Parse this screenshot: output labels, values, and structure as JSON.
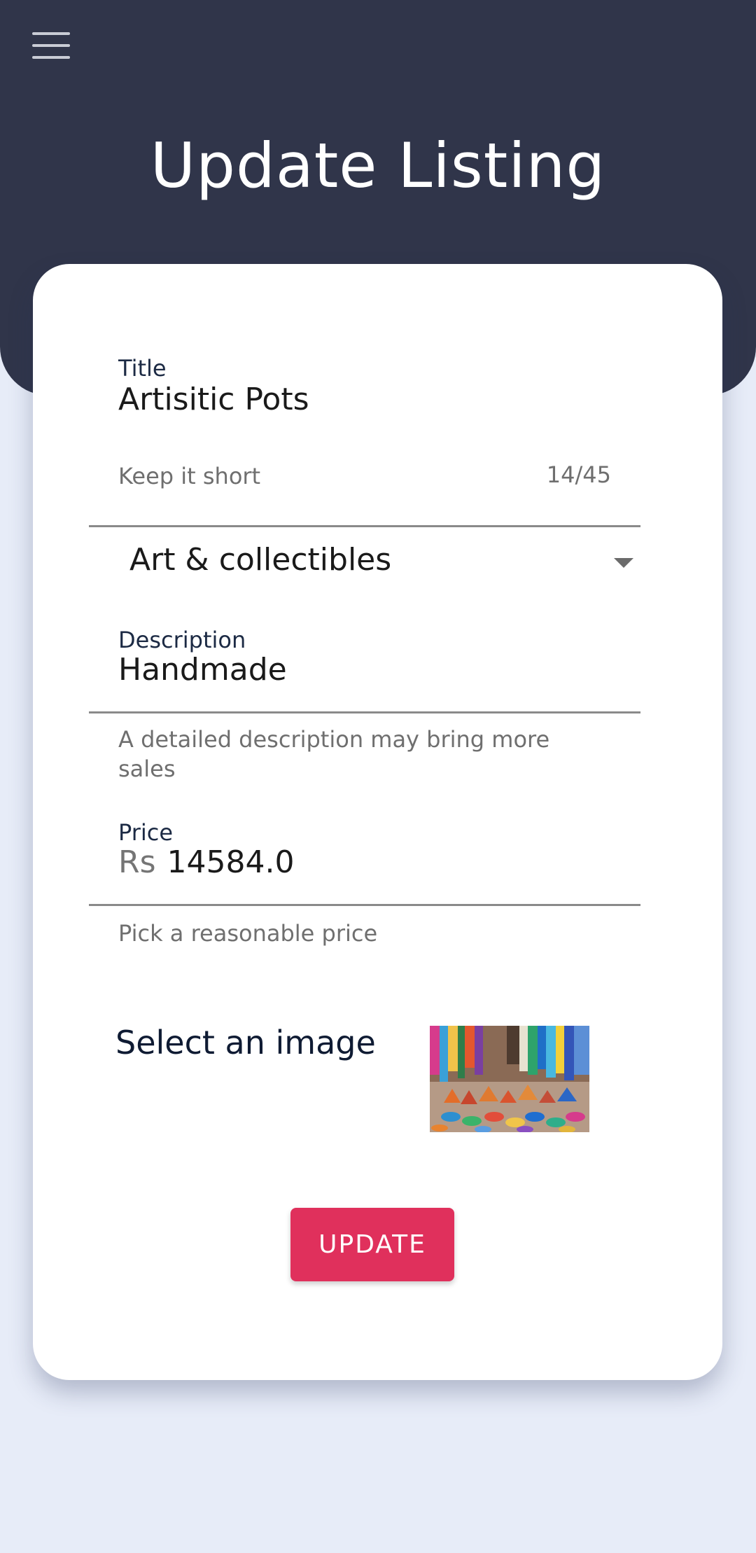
{
  "header": {
    "title": "Update Listing",
    "menu_icon": "hamburger-menu-icon",
    "background_color": "#30354a"
  },
  "form": {
    "title_field": {
      "label": "Title",
      "value": "Artisitic Pots",
      "helper": "Keep it short",
      "counter": "14/45"
    },
    "category": {
      "selected": "Art & collectibles",
      "dropdown_icon": "dropdown-arrow-icon"
    },
    "description_field": {
      "label": "Description",
      "value": "Handmade",
      "helper": "A detailed description may bring more sales"
    },
    "price_field": {
      "label": "Price",
      "prefix": "Rs",
      "value": "14584.0",
      "helper": "Pick a reasonable price"
    },
    "image": {
      "label": "Select an image",
      "thumbnail": "market-pottery-thumbnail"
    },
    "submit": {
      "label": "UPDATE",
      "color": "#e0305c"
    }
  }
}
